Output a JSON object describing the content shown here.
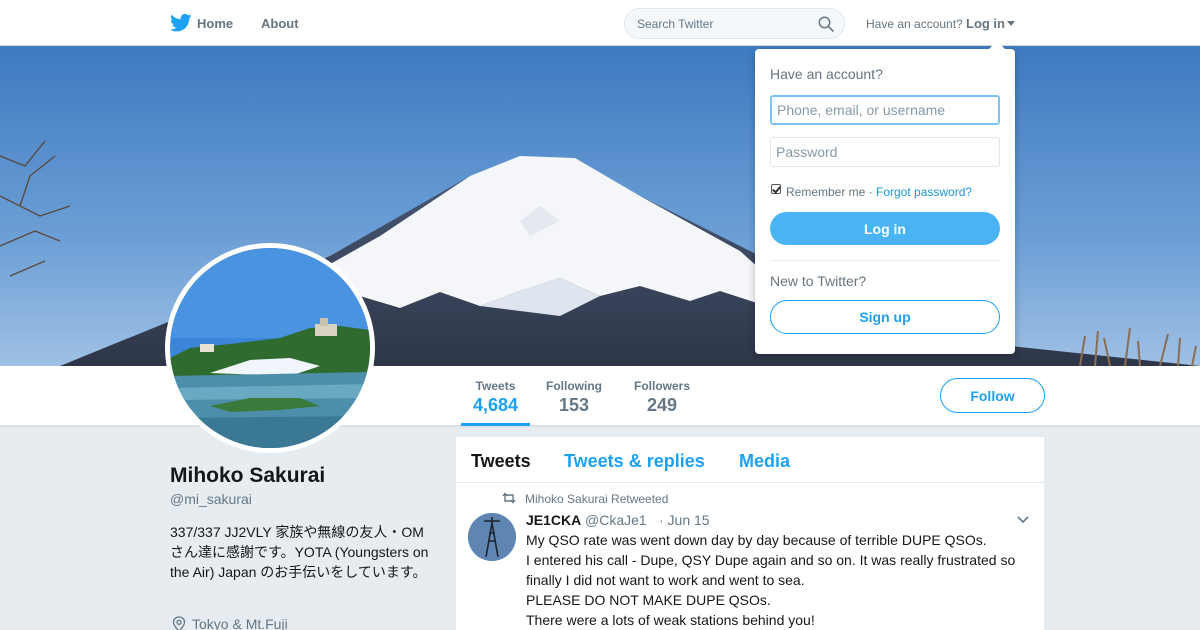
{
  "nav": {
    "home": "Home",
    "about": "About",
    "search_placeholder": "Search Twitter",
    "have_account": "Have an account?",
    "login": "Log in"
  },
  "profile": {
    "name": "Mihoko Sakurai",
    "handle": "@mi_sakurai",
    "bio": "337/337 JJ2VLY 家族や無線の友人・OMさん達に感謝です。YOTA (Youngsters on the Air) Japan のお手伝いをしています。",
    "location": "Tokyo & Mt.Fuji",
    "follow_label": "Follow"
  },
  "stats": [
    {
      "label": "Tweets",
      "value": "4,684",
      "active": true
    },
    {
      "label": "Following",
      "value": "153",
      "active": false
    },
    {
      "label": "Followers",
      "value": "249",
      "active": false
    }
  ],
  "timeline": {
    "tabs": [
      {
        "label": "Tweets",
        "active": true
      },
      {
        "label": "Tweets & replies",
        "active": false
      },
      {
        "label": "Media",
        "active": false
      }
    ],
    "tweet": {
      "retweeted_by": "Mihoko Sakurai Retweeted",
      "author_name": "JE1CKA",
      "author_handle": "@CkaJe1",
      "time": "· Jun 15",
      "text": "My QSO rate was went down day by day because of terrible DUPE QSOs.\nI entered his call - Dupe, QSY Dupe again and so on. It was really frustrated so finally I did not want to work  and went to sea.\nPLEASE DO NOT MAKE DUPE QSOs.\nThere were a lots of weak stations behind you!"
    }
  },
  "login_dropdown": {
    "title": "Have an account?",
    "username_placeholder": "Phone, email, or username",
    "password_placeholder": "Password",
    "remember_me": "Remember me ·",
    "forgot_password": "Forgot password?",
    "login_button": "Log in",
    "new_to_twitter": "New to Twitter?",
    "signup_button": "Sign up"
  },
  "colors": {
    "brand": "#1da1f2",
    "background": "#e6ecf0",
    "text_primary": "#14171a",
    "text_secondary": "#657786"
  },
  "icons": [
    "twitter-bird-icon",
    "search-icon",
    "caret-down-icon",
    "location-pin-icon",
    "retweet-icon",
    "chevron-down-icon"
  ]
}
